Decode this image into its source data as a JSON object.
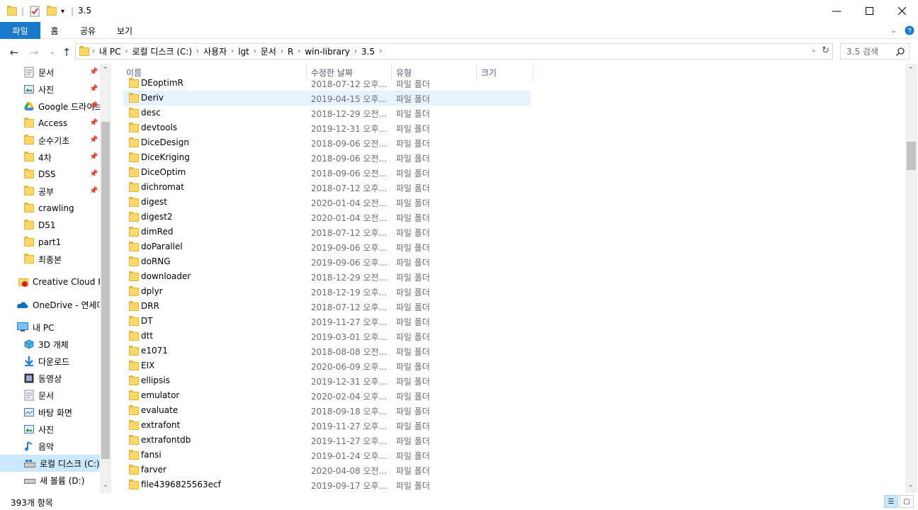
{
  "window": {
    "title": "3.5"
  },
  "ribbon": {
    "tabs": [
      "파일",
      "홈",
      "공유",
      "보기"
    ]
  },
  "address": {
    "crumbs": [
      "내 PC",
      "로컬 디스크 (C:)",
      "사용자",
      "lgt",
      "문서",
      "R",
      "win-library",
      "3.5"
    ]
  },
  "search": {
    "placeholder": "3.5 검색"
  },
  "nav": {
    "quick": [
      {
        "label": "문서",
        "pinned": true
      },
      {
        "label": "사진",
        "pinned": true
      },
      {
        "label": "Google 드라이브",
        "pinned": true
      },
      {
        "label": "Access",
        "pinned": true
      },
      {
        "label": "순수기초",
        "pinned": true
      },
      {
        "label": "4차",
        "pinned": true
      },
      {
        "label": "DSS",
        "pinned": true
      },
      {
        "label": "공부",
        "pinned": true
      },
      {
        "label": "crawling",
        "pinned": false
      },
      {
        "label": "D51",
        "pinned": false
      },
      {
        "label": "part1",
        "pinned": false
      },
      {
        "label": "최종본",
        "pinned": false
      }
    ],
    "creative_cloud": "Creative Cloud Files",
    "onedrive": "OneDrive - 연세대",
    "this_pc": "내 PC",
    "pc_items": [
      "3D 개체",
      "다운로드",
      "동영상",
      "문서",
      "바탕 화면",
      "사진",
      "음악",
      "로컬 디스크 (C:)",
      "새 볼륨 (D:)"
    ]
  },
  "columns": {
    "name": "이름",
    "date": "수정한 날짜",
    "type": "유형",
    "size": "크기"
  },
  "files": [
    {
      "name": "DEoptimR",
      "date": "2018-07-12 오후...",
      "type": "파일 폴더"
    },
    {
      "name": "Deriv",
      "date": "2019-04-15 오후...",
      "type": "파일 폴더"
    },
    {
      "name": "desc",
      "date": "2018-12-29 오전...",
      "type": "파일 폴더"
    },
    {
      "name": "devtools",
      "date": "2019-12-31 오후...",
      "type": "파일 폴더"
    },
    {
      "name": "DiceDesign",
      "date": "2018-09-06 오전...",
      "type": "파일 폴더"
    },
    {
      "name": "DiceKriging",
      "date": "2018-09-06 오전...",
      "type": "파일 폴더"
    },
    {
      "name": "DiceOptim",
      "date": "2018-09-06 오전...",
      "type": "파일 폴더"
    },
    {
      "name": "dichromat",
      "date": "2018-07-12 오후...",
      "type": "파일 폴더"
    },
    {
      "name": "digest",
      "date": "2020-01-04 오전...",
      "type": "파일 폴더"
    },
    {
      "name": "digest2",
      "date": "2020-01-04 오전...",
      "type": "파일 폴더"
    },
    {
      "name": "dimRed",
      "date": "2018-07-12 오후...",
      "type": "파일 폴더"
    },
    {
      "name": "doParallel",
      "date": "2019-09-06 오후...",
      "type": "파일 폴더"
    },
    {
      "name": "doRNG",
      "date": "2019-09-06 오후...",
      "type": "파일 폴더"
    },
    {
      "name": "downloader",
      "date": "2018-12-29 오전...",
      "type": "파일 폴더"
    },
    {
      "name": "dplyr",
      "date": "2018-12-19 오후...",
      "type": "파일 폴더"
    },
    {
      "name": "DRR",
      "date": "2018-07-12 오후...",
      "type": "파일 폴더"
    },
    {
      "name": "DT",
      "date": "2019-11-27 오후...",
      "type": "파일 폴더"
    },
    {
      "name": "dtt",
      "date": "2019-03-01 오후...",
      "type": "파일 폴더"
    },
    {
      "name": "e1071",
      "date": "2018-08-08 오전...",
      "type": "파일 폴더"
    },
    {
      "name": "EIX",
      "date": "2020-06-09 오후...",
      "type": "파일 폴더"
    },
    {
      "name": "ellipsis",
      "date": "2019-12-31 오후...",
      "type": "파일 폴더"
    },
    {
      "name": "emulator",
      "date": "2020-02-04 오후...",
      "type": "파일 폴더"
    },
    {
      "name": "evaluate",
      "date": "2018-09-18 오후...",
      "type": "파일 폴더"
    },
    {
      "name": "extrafont",
      "date": "2019-11-27 오후...",
      "type": "파일 폴더"
    },
    {
      "name": "extrafontdb",
      "date": "2019-11-27 오후...",
      "type": "파일 폴더"
    },
    {
      "name": "fansi",
      "date": "2019-01-24 오후...",
      "type": "파일 폴더"
    },
    {
      "name": "farver",
      "date": "2020-04-08 오전...",
      "type": "파일 폴더"
    },
    {
      "name": "file4396825563ecf",
      "date": "2019-09-17 오후...",
      "type": "파일 폴더"
    }
  ],
  "status": {
    "count": "393개 항목"
  },
  "colors": {
    "accent": "#1979ca",
    "selection": "#cce8ff",
    "hover": "#e5f3ff",
    "folder": "#ffd867"
  }
}
